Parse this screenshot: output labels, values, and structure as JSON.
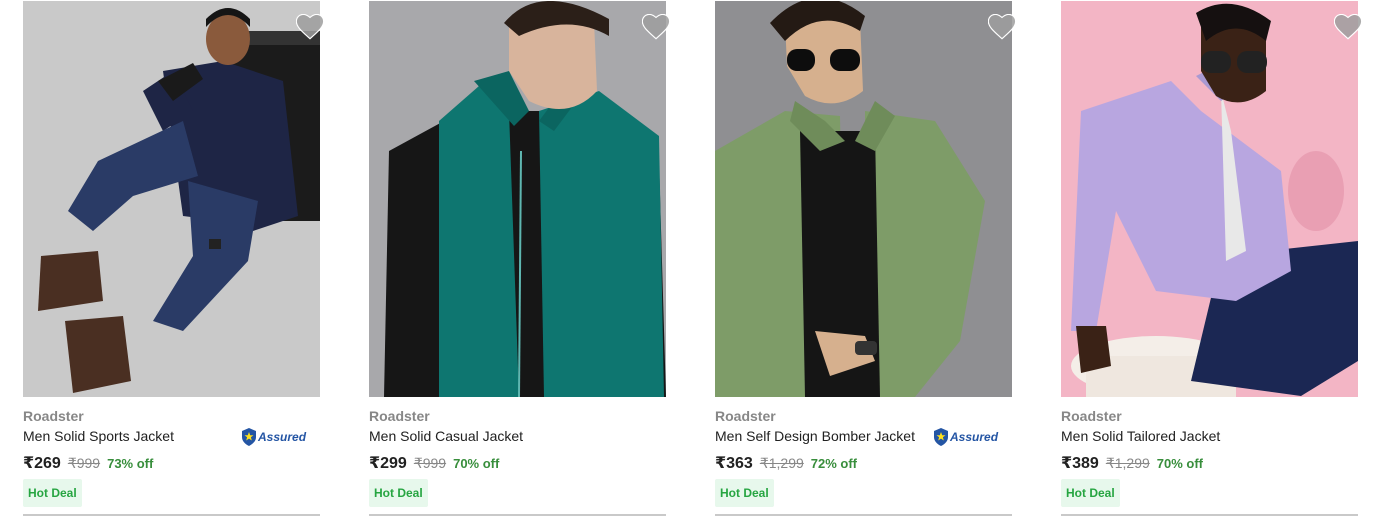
{
  "products": [
    {
      "brand": "Roadster",
      "title": "Men Solid Sports Jacket",
      "price": "₹269",
      "mrp": "₹999",
      "discount": "73% off",
      "badge": "Hot Deal",
      "assured": true,
      "assured_text": "Assured",
      "image_icon": "model-navy-sweater-photo",
      "colors": {
        "background": "#c8c8c8",
        "garment": "#1e2545",
        "pants": "#2a3b66"
      }
    },
    {
      "brand": "Roadster",
      "title": "Men Solid Casual Jacket",
      "price": "₹299",
      "mrp": "₹999",
      "discount": "70% off",
      "badge": "Hot Deal",
      "assured": false,
      "image_icon": "model-teal-vest-photo",
      "colors": {
        "background": "#a7a7aa",
        "garment": "#0e7670",
        "pants": "#161616"
      }
    },
    {
      "brand": "Roadster",
      "title": "Men Self Design Bomber Jacket",
      "price": "₹363",
      "mrp": "₹1,299",
      "discount": "72% off",
      "badge": "Hot Deal",
      "assured": true,
      "assured_text": "Assured",
      "image_icon": "model-green-fleece-photo",
      "colors": {
        "background": "#8e8e91",
        "garment": "#7e9c68",
        "pants": "#151515"
      }
    },
    {
      "brand": "Roadster",
      "title": "Men Solid Tailored Jacket",
      "price": "₹389",
      "mrp": "₹1,299",
      "discount": "70% off",
      "badge": "Hot Deal",
      "assured": false,
      "image_icon": "model-lavender-fleece-photo",
      "colors": {
        "background": "#f3b6c6",
        "garment": "#b8a6e0",
        "pants": "#1b2753"
      }
    }
  ],
  "wishlist_icon": "heart-icon",
  "assured_icon": "shield-icon"
}
